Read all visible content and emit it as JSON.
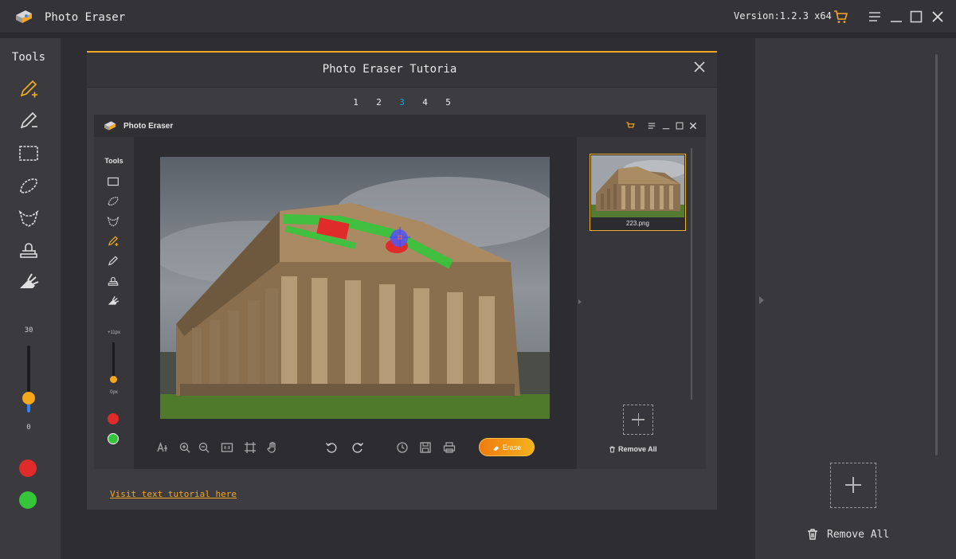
{
  "app": {
    "title": "Photo Eraser",
    "version": "Version:1.2.3 x64",
    "accent_color": "#f5a623",
    "titlebar_icons": [
      "cart-icon",
      "menu-icon",
      "minimize-icon",
      "maximize-icon",
      "close-icon"
    ]
  },
  "tools_panel": {
    "title": "Tools",
    "tools": [
      "pencil-plus-icon",
      "pencil-minus-icon",
      "rectangle-select-icon",
      "lasso-select-icon",
      "polygon-select-icon",
      "stamp-icon",
      "smart-eraser-icon"
    ],
    "brush_size": {
      "max": "30",
      "min": "0"
    },
    "colors": [
      "#e02b2b",
      "#34c53a"
    ]
  },
  "right_panel": {
    "remove_all": "Remove All"
  },
  "tutorial": {
    "title": "Photo Eraser Tutoria",
    "steps": [
      "1",
      "2",
      "3",
      "4",
      "5"
    ],
    "active_step": "3",
    "link_text": "Visit text tutorial here",
    "preview": {
      "title": "Photo Eraser",
      "tools_title": "Tools",
      "brush_max": "+11px",
      "brush_min": "0px",
      "erase_label": "Erase",
      "file_name": "223.png",
      "remove_all": "Remove All"
    }
  }
}
